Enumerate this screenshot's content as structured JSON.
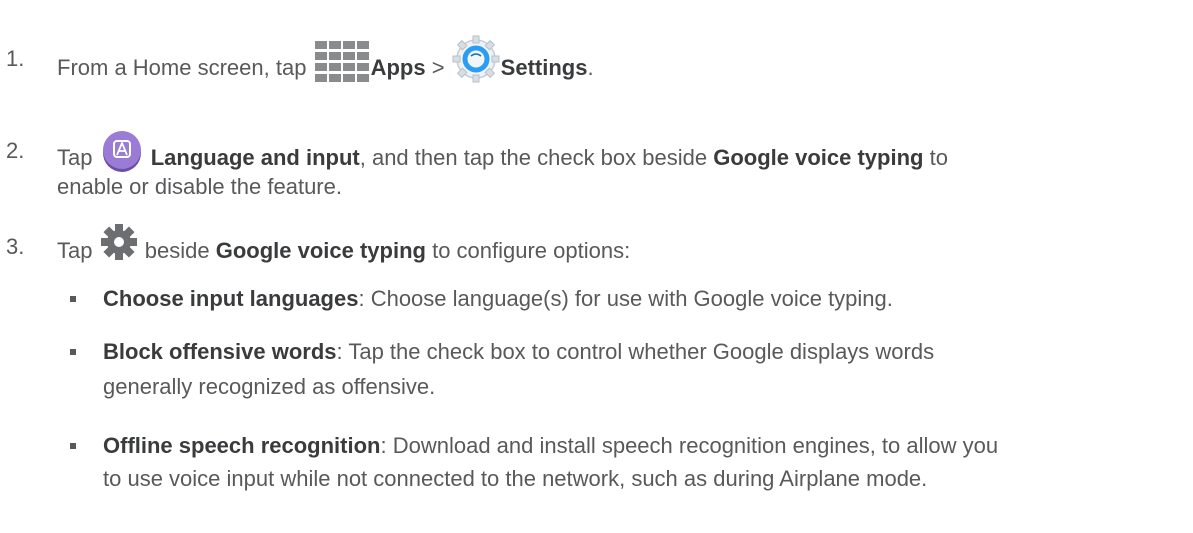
{
  "steps": [
    {
      "number": "1.",
      "parts": {
        "a": "From a Home screen, tap",
        "apps": "Apps",
        "sep": ">",
        "settings": "Settings",
        "end": "."
      }
    },
    {
      "number": "2.",
      "parts": {
        "a": "Tap",
        "lang": "Language and input",
        "b": ", and then tap the check box beside",
        "gvt": "Google voice typing",
        "c": "to",
        "line2": "enable or disable the feature."
      }
    },
    {
      "number": "3.",
      "parts": {
        "a": "Tap",
        "b": "beside",
        "gvt": "Google voice typing",
        "c": "to configure options:"
      }
    }
  ],
  "options": [
    {
      "title": "Choose input languages",
      "desc": ": Choose language(s) for use with Google voice typing.",
      "line2": ""
    },
    {
      "title": "Block offensive words",
      "desc": ": Tap the check box to control whether Google displays words",
      "line2": "generally recognized as offensive."
    },
    {
      "title": "Offline speech recognition",
      "desc": ": Download and install speech recognition engines, to allow you",
      "line2": "to use voice input while not connected to the network, such as during Airplane mode."
    }
  ],
  "icons": {
    "apps": "apps-grid-icon",
    "settings": "settings-gear-icon",
    "language": "language-input-icon",
    "gear": "gear-icon"
  },
  "colors": {
    "text": "#58595b",
    "bold": "#3a3b3d",
    "settings_blue": "#2a9df4",
    "language_purple": "#8c6bc8",
    "gear_gray": "#6d6e71"
  }
}
